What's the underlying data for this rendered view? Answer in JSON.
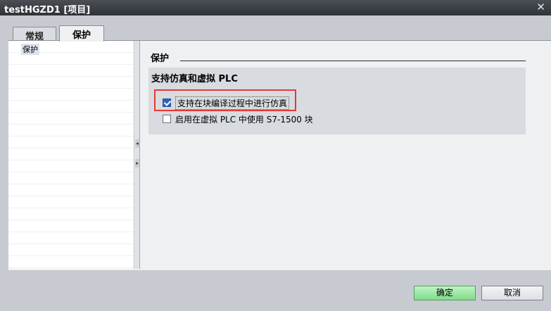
{
  "window": {
    "title": "testHGZD1 [项目]",
    "close_symbol": "✕"
  },
  "tabs": [
    {
      "label": "常规",
      "active": false
    },
    {
      "label": "保护",
      "active": true
    }
  ],
  "nav": {
    "items": [
      {
        "label": "保护",
        "selected": true
      }
    ]
  },
  "splitter": {
    "collapse_symbol": "◂",
    "expand_symbol": "▸"
  },
  "section": {
    "title": "保护",
    "group": {
      "title": "支持仿真和虚拟 PLC",
      "options": [
        {
          "label": "支持在块编译过程中进行仿真",
          "checked": true
        },
        {
          "label": "启用在虚拟 PLC 中使用 S7-1500 块",
          "checked": false
        }
      ]
    }
  },
  "buttons": {
    "ok": "确定",
    "cancel": "取消"
  },
  "colors": {
    "highlight": "#e53935",
    "ok_button": "#7fdc8a",
    "checkbox_checked": "#2a63c7"
  }
}
